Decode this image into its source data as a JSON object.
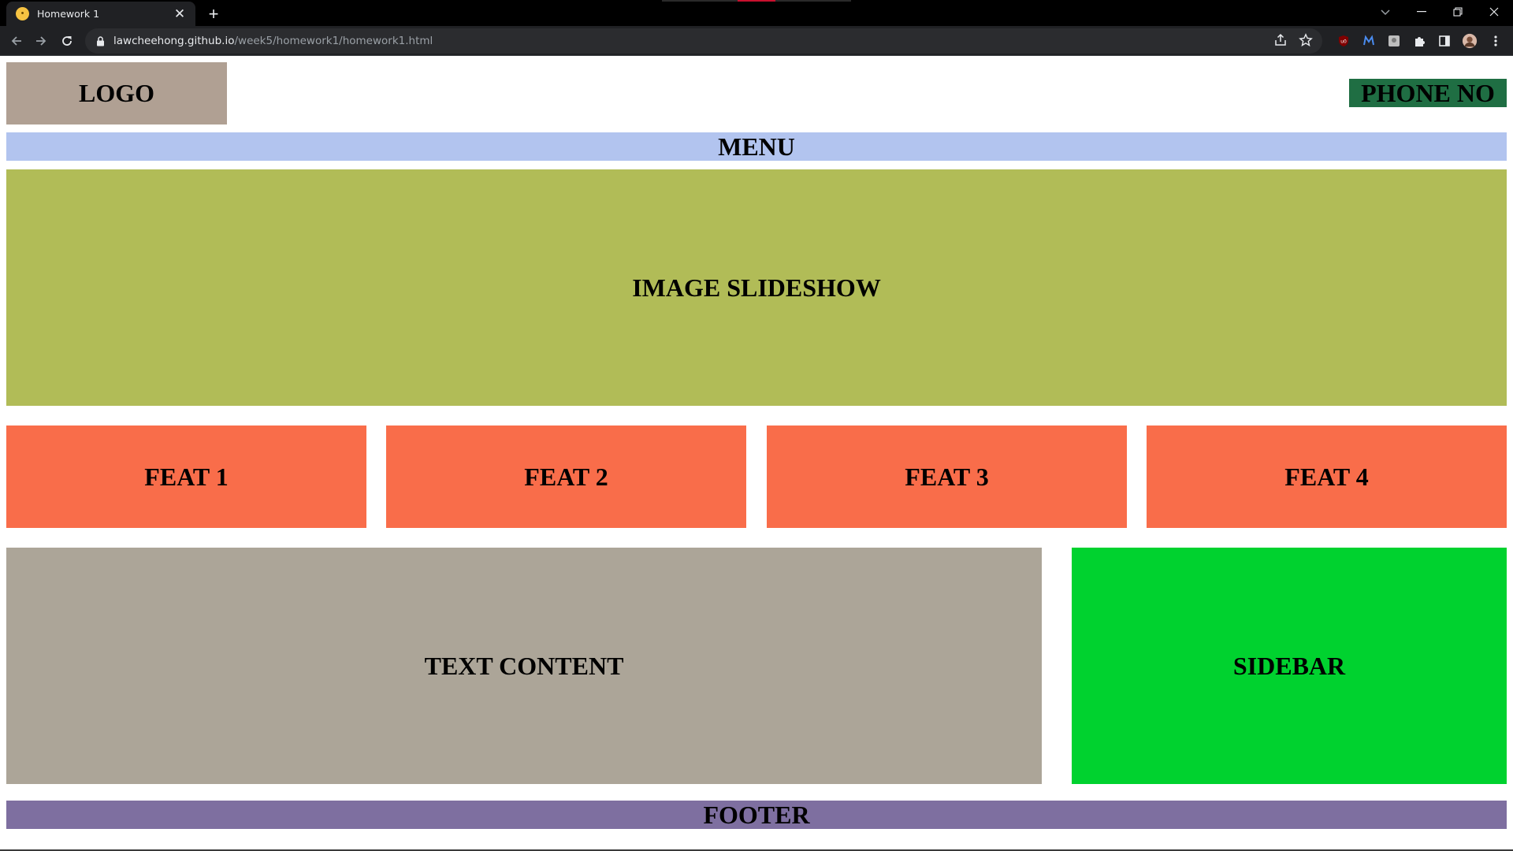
{
  "browser": {
    "tab_title": "Homework 1",
    "tab_close_glyph": "✕",
    "new_tab_glyph": "+",
    "url_host": "lawcheehong.github.io",
    "url_path": "/week5/homework1/homework1.html",
    "icons": [
      "back-icon",
      "forward-icon",
      "reload-icon",
      "lock-icon",
      "share-icon",
      "star-icon",
      "ublock-icon",
      "extension-m-icon",
      "extension-photo-icon",
      "extensions-puzzle-icon",
      "side-panel-icon",
      "profile-avatar-icon",
      "kebab-menu-icon"
    ]
  },
  "header": {
    "logo": "LOGO",
    "phone": "PHONE NO"
  },
  "menu": {
    "label": "MENU"
  },
  "slideshow": {
    "label": "IMAGE SLIDESHOW"
  },
  "features": [
    {
      "label": "FEAT 1"
    },
    {
      "label": "FEAT 2"
    },
    {
      "label": "FEAT 3"
    },
    {
      "label": "FEAT 4"
    }
  ],
  "content": {
    "label": "TEXT CONTENT"
  },
  "sidebar": {
    "label": "SIDEBAR"
  },
  "footer": {
    "label": "FOOTER"
  },
  "colors": {
    "logo_bg": "#b0a093",
    "phone_bg": "#1f6e43",
    "menu_bg": "#b2c4ef",
    "slideshow_bg": "#b1bc57",
    "feature_bg": "#f96d4a",
    "content_bg": "#aca598",
    "sidebar_bg": "#00d22f",
    "footer_bg": "#7e6fa0"
  }
}
